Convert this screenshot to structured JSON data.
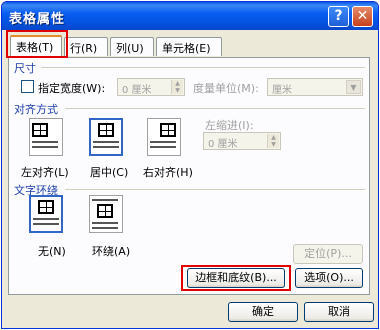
{
  "window": {
    "title": "表格属性"
  },
  "title_buttons": {
    "help": "?",
    "close": "✕"
  },
  "tabs": [
    {
      "label": "表格(T)"
    },
    {
      "label": "行(R)"
    },
    {
      "label": "列(U)"
    },
    {
      "label": "单元格(E)"
    }
  ],
  "size": {
    "title": "尺寸",
    "preferred_width_label": "指定宽度(W):",
    "width_value": "0 厘米",
    "unit_label": "度量单位(M):",
    "unit_value": "厘米"
  },
  "alignment": {
    "title": "对齐方式",
    "options": [
      {
        "label": "左对齐(L)"
      },
      {
        "label": "居中(C)"
      },
      {
        "label": "右对齐(H)"
      }
    ],
    "indent_label": "左缩进(I):",
    "indent_value": "0 厘米"
  },
  "wrapping": {
    "title": "文字环绕",
    "options": [
      {
        "label": "无(N)"
      },
      {
        "label": "环绕(A)"
      }
    ]
  },
  "buttons": {
    "position": "定位(P)...",
    "borders": "边框和底纹(B)...",
    "options": "选项(O)...",
    "ok": "确定",
    "cancel": "取消"
  }
}
